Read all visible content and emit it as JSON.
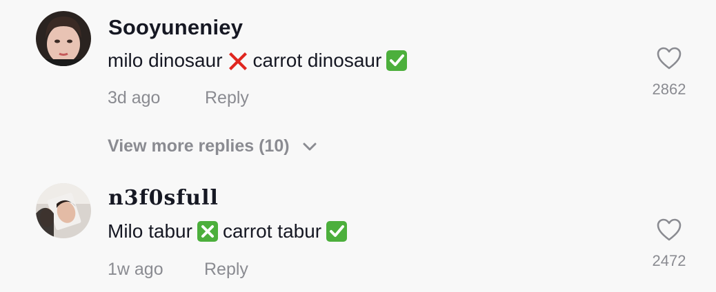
{
  "comments": [
    {
      "username": "Sooyuneniey",
      "segments": [
        "milo dinosaur",
        "carrot dinosaur"
      ],
      "emojis": [
        "cross-mark-emoji",
        "check-mark-button-emoji"
      ],
      "time": "3d ago",
      "reply_label": "Reply",
      "like_count": "2862",
      "icon": "heart-outline-icon"
    },
    {
      "username": "n3f0sfull",
      "segments": [
        "Milo tabur",
        "carrot tabur"
      ],
      "emojis": [
        "cross-mark-button-emoji",
        "check-mark-button-emoji"
      ],
      "time": "1w ago",
      "reply_label": "Reply",
      "like_count": "2472",
      "icon": "heart-outline-icon"
    }
  ],
  "view_more_replies": "View more replies (10)",
  "colors": {
    "background": "#f8f8f8",
    "primary_text": "#161823",
    "secondary_text": "#8a8b91",
    "cross_red": "#e0261f",
    "check_green": "#4caf3c"
  }
}
